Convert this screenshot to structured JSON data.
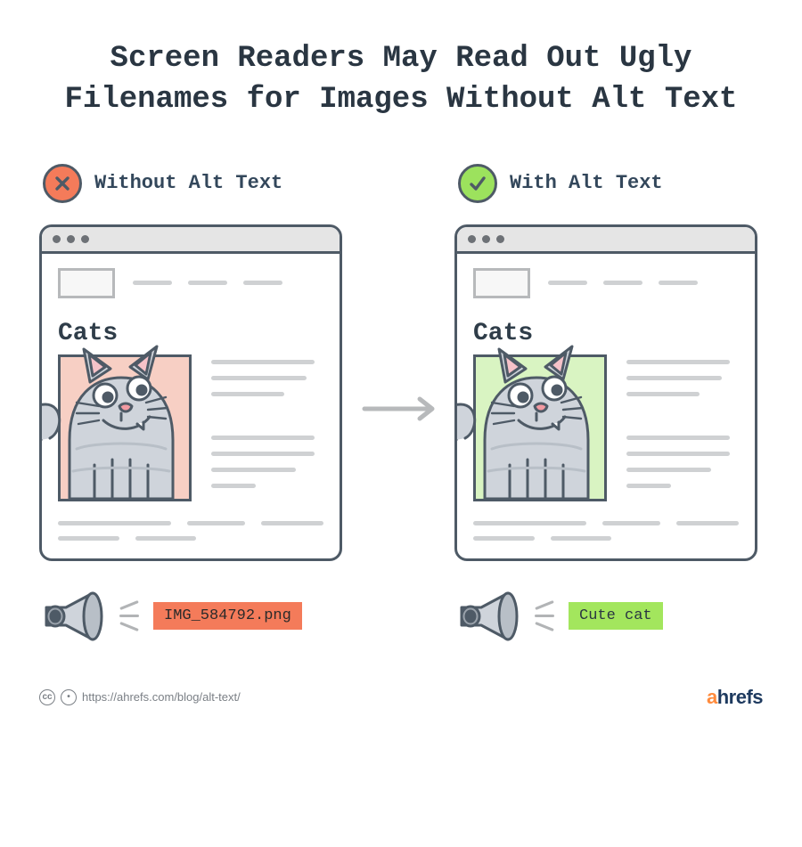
{
  "title": "Screen Readers May Read Out Ugly Filenames for Images Without Alt Text",
  "left": {
    "badge": "Without Alt Text",
    "page_heading": "Cats",
    "readout": "IMG_584792.png"
  },
  "right": {
    "badge": "With Alt Text",
    "page_heading": "Cats",
    "readout": "Cute cat"
  },
  "footer": {
    "url": "https://ahrefs.com/blog/alt-text/",
    "brand_a": "a",
    "brand_rest": "hrefs"
  }
}
